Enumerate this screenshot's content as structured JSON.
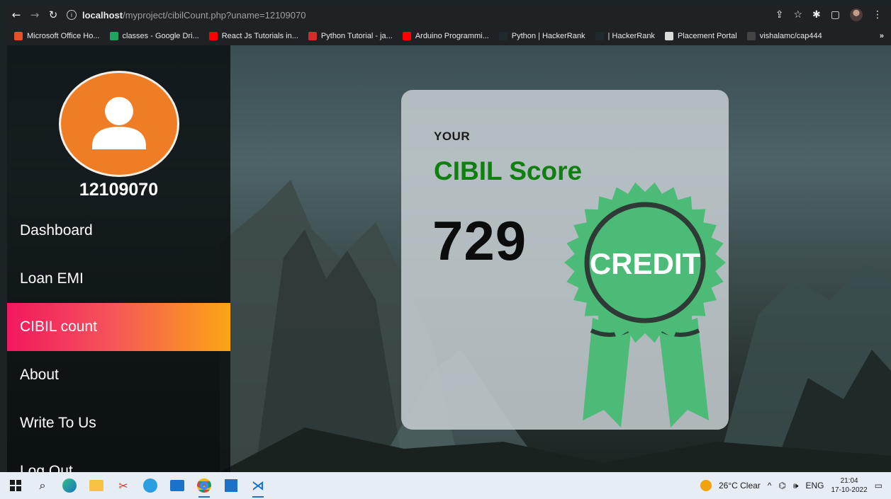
{
  "browser": {
    "url_host": "localhost",
    "url_path": "/myproject/cibilCount.php?uname=12109070",
    "bookmarks": [
      {
        "label": "Microsoft Office Ho...",
        "color": "#e3502a"
      },
      {
        "label": "classes - Google Dri...",
        "color": "#1fa463"
      },
      {
        "label": "React Js Tutorials in...",
        "color": "#ff0000"
      },
      {
        "label": "Python Tutorial - ja...",
        "color": "#d62b2b"
      },
      {
        "label": "Arduino Programmi...",
        "color": "#ff0000"
      },
      {
        "label": "Python | HackerRank",
        "color": "#1f2a2e"
      },
      {
        "label": "| HackerRank",
        "color": "#1f2a2e"
      },
      {
        "label": "Placement Portal",
        "color": "#dcdcdc"
      },
      {
        "label": "vishalamc/cap444",
        "color": "#444444"
      }
    ],
    "more": "»"
  },
  "sidebar": {
    "username": "12109070",
    "items": [
      {
        "label": "Dashboard"
      },
      {
        "label": "Loan EMI"
      },
      {
        "label": "CIBIL count"
      },
      {
        "label": "About"
      },
      {
        "label": "Write To Us"
      },
      {
        "label": "Log Out"
      }
    ],
    "active_index": 2
  },
  "card": {
    "pre_title": "YOUR",
    "title": "CIBIL Score",
    "score": "729",
    "badge_text": "CREDIT"
  },
  "taskbar": {
    "weather": "26°C  Clear",
    "lang": "ENG",
    "time": "21:04",
    "date": "17-10-2022"
  },
  "colors": {
    "accent_start": "#f2185e",
    "accent_end": "#fba614",
    "title_green": "#0f7f10",
    "badge_green": "#4cbb78",
    "avatar_orange": "#ef7d26"
  }
}
